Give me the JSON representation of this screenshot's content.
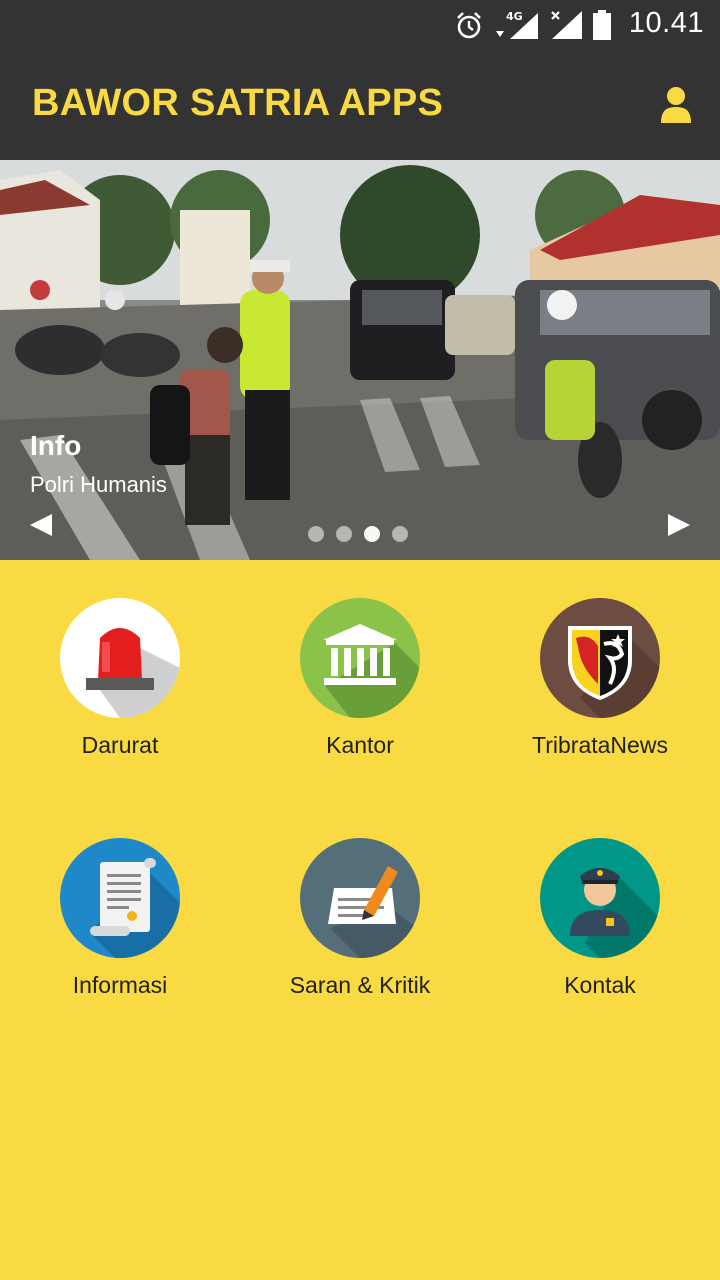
{
  "status_bar": {
    "network": "4G",
    "time": "10.41"
  },
  "app_bar": {
    "title": "BAWOR SATRIA APPS",
    "profile_icon": "person-icon"
  },
  "slider": {
    "caption_title": "Info",
    "caption_subtitle": "Polri Humanis",
    "slide_count": 4,
    "active_slide": 3
  },
  "menu": {
    "items": [
      {
        "label": "Darurat",
        "icon": "siren-icon"
      },
      {
        "label": "Kantor",
        "icon": "building-icon"
      },
      {
        "label": "TribrataNews",
        "icon": "police-badge-icon"
      },
      {
        "label": "Informasi",
        "icon": "scroll-document-icon"
      },
      {
        "label": "Saran & Kritik",
        "icon": "pencil-paper-icon"
      },
      {
        "label": "Kontak",
        "icon": "police-officer-icon"
      }
    ]
  },
  "colors": {
    "accent": "#f9da43",
    "appbar": "#333333",
    "darurat_bg": "#ffffff",
    "kantor_bg": "#8bc34a",
    "tribrata_bg": "#6d4c41",
    "informasi_bg": "#1e88c8",
    "saran_bg": "#546e7a",
    "kontak_bg": "#009688"
  }
}
